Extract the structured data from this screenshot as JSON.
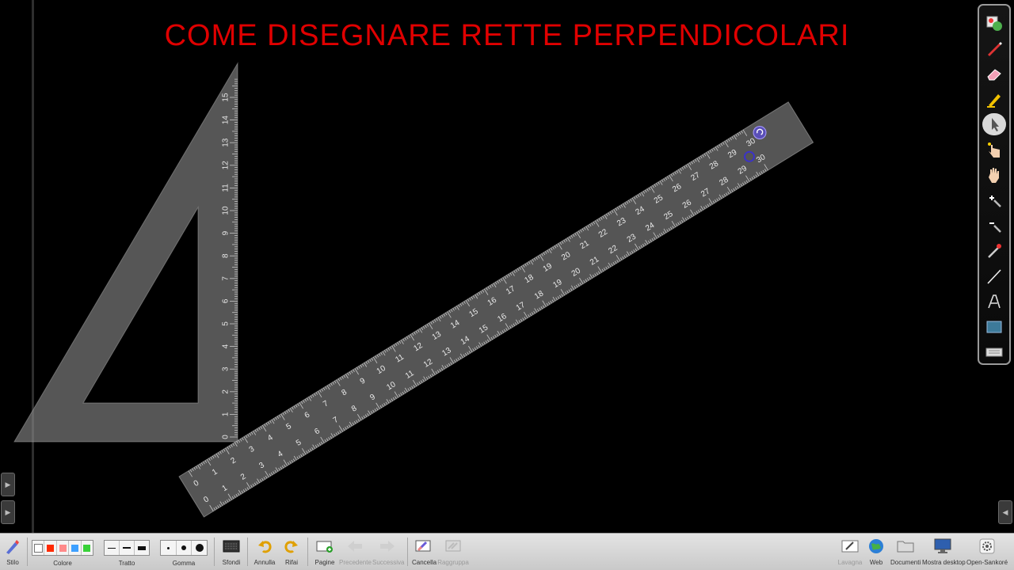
{
  "board": {
    "title": "COME DISEGNARE RETTE PERPENDICOLARI",
    "title_color": "#e00000",
    "background": "#000000"
  },
  "set_square": {
    "scale_labels": [
      "1",
      "2",
      "3",
      "4",
      "5",
      "6",
      "7",
      "8",
      "9",
      "10",
      "11",
      "12",
      "13",
      "14",
      "15"
    ],
    "zero_label": "0"
  },
  "ruler": {
    "top_labels": [
      "0",
      "1",
      "2",
      "3",
      "4",
      "5",
      "6",
      "7",
      "8",
      "9",
      "10",
      "11",
      "12",
      "13",
      "14",
      "15",
      "16",
      "17",
      "18",
      "19",
      "20",
      "21",
      "22",
      "23",
      "24",
      "25",
      "26",
      "27",
      "28",
      "29",
      "30"
    ],
    "bottom_labels": [
      "0",
      "1",
      "2",
      "3",
      "4",
      "5",
      "6",
      "7",
      "8",
      "9",
      "10",
      "11",
      "12",
      "13",
      "14",
      "15",
      "16",
      "17",
      "18",
      "19",
      "20",
      "21",
      "22",
      "23",
      "24",
      "25",
      "26",
      "27",
      "28",
      "29",
      "30"
    ]
  },
  "palette": {
    "tools": [
      {
        "name": "color-picker-icon"
      },
      {
        "name": "pen-icon"
      },
      {
        "name": "eraser-icon"
      },
      {
        "name": "highlighter-icon"
      },
      {
        "name": "selector-icon"
      },
      {
        "name": "interact-hand-icon"
      },
      {
        "name": "pan-hand-icon"
      },
      {
        "name": "zoom-in-icon"
      },
      {
        "name": "zoom-out-icon"
      },
      {
        "name": "laser-pointer-icon"
      },
      {
        "name": "line-icon"
      },
      {
        "name": "text-icon"
      },
      {
        "name": "capture-icon"
      },
      {
        "name": "keyboard-icon"
      }
    ]
  },
  "toolbar": {
    "stylus": "Stilo",
    "color": "Colore",
    "stroke": "Tratto",
    "eraser": "Gomma",
    "backgrounds": "Sfondi",
    "undo": "Annulla",
    "redo": "Rifai",
    "pages": "Pagine",
    "previous": "Precedente",
    "next": "Successiva",
    "clear": "Cancella",
    "group": "Raggruppa",
    "board": "Lavagna",
    "web": "Web",
    "documents": "Documenti",
    "show_desktop": "Mostra desktop",
    "open_sankore": "Open-Sankoré",
    "colors": [
      "#ffffff",
      "#ff2a00",
      "#ff8a8a",
      "#3ea0ff",
      "#39d239"
    ]
  }
}
